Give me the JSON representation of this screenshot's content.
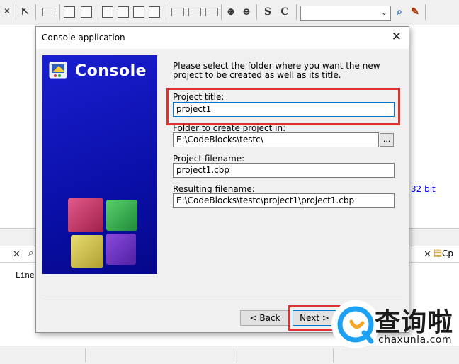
{
  "ide": {
    "link_text": "32 bit",
    "tab_label": "Cp",
    "log_text": "Line"
  },
  "dialog": {
    "title": "Console application",
    "close_glyph": "✕",
    "banner_title": "Console",
    "instruction": "Please select the folder where you want the new project to be created as well as its title.",
    "project_title": {
      "label": "Project title:",
      "value": "project1"
    },
    "folder": {
      "label": "Folder to create project in:",
      "value": "E:\\CodeBlocks\\testc\\",
      "browse_label": "..."
    },
    "project_filename": {
      "label": "Project filename:",
      "value": "project1.cbp"
    },
    "resulting_filename": {
      "label": "Resulting filename:",
      "value": "E:\\CodeBlocks\\testc\\project1\\project1.cbp"
    },
    "buttons": {
      "back": "< Back",
      "next": "Next >"
    },
    "highlight_color": "#e03030"
  },
  "watermark": {
    "main": "查询啦",
    "sub": "chaxunla.com"
  }
}
